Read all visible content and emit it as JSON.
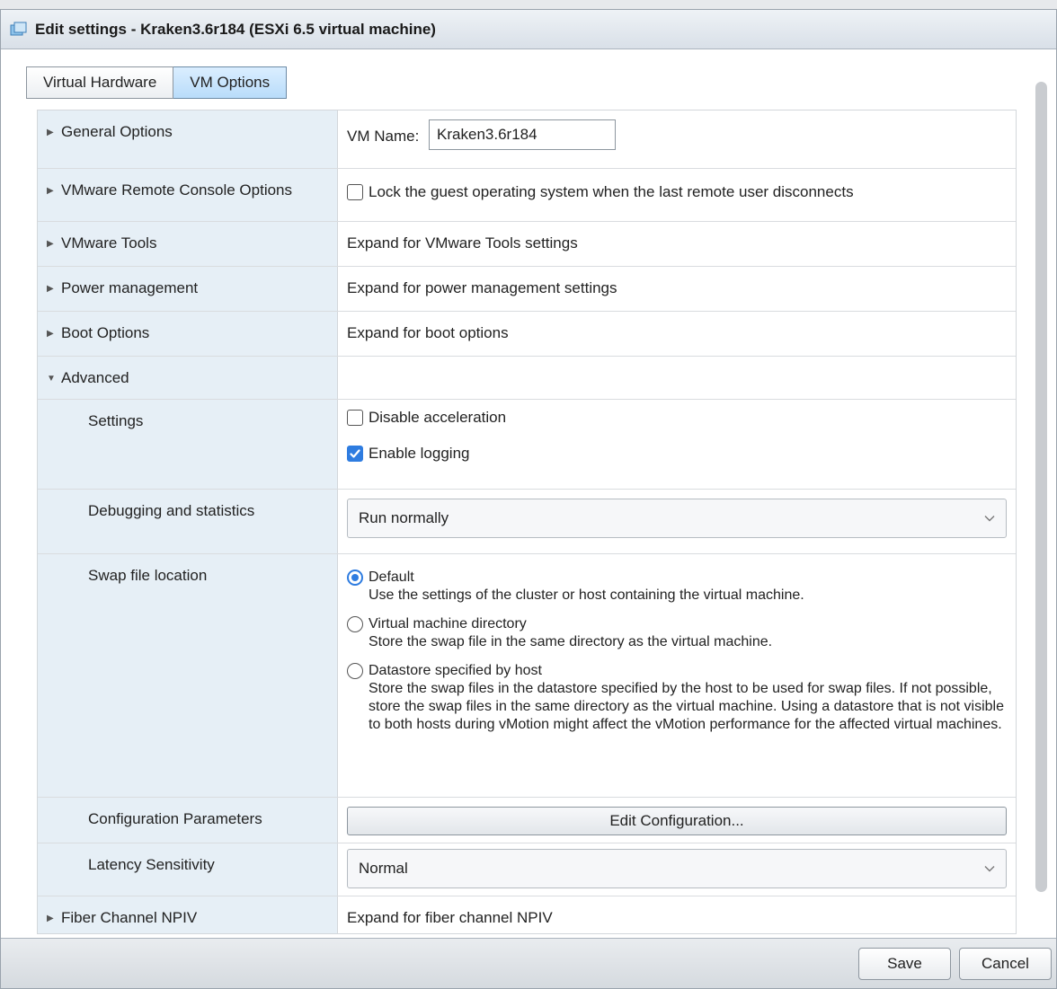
{
  "window": {
    "title": "Edit settings - Kraken3.6r184 (ESXi 6.5 virtual machine)"
  },
  "tabs": [
    {
      "label": "Virtual Hardware",
      "active": false
    },
    {
      "label": "VM Options",
      "active": true
    }
  ],
  "general_options": {
    "label": "General Options",
    "vm_name_label": "VM Name:",
    "vm_name_value": "Kraken3.6r184"
  },
  "remote_console": {
    "label": "VMware Remote Console Options",
    "lock_label": "Lock the guest operating system when the last remote user disconnects",
    "lock_checked": false
  },
  "vmware_tools": {
    "label": "VMware Tools",
    "value": "Expand for VMware Tools settings"
  },
  "power_management": {
    "label": "Power management",
    "value": "Expand for power management settings"
  },
  "boot_options": {
    "label": "Boot Options",
    "value": "Expand for boot options"
  },
  "advanced": {
    "label": "Advanced",
    "settings": {
      "label": "Settings",
      "disable_acceleration": {
        "label": "Disable acceleration",
        "checked": false
      },
      "enable_logging": {
        "label": "Enable logging",
        "checked": true
      }
    },
    "debugging": {
      "label": "Debugging and statistics",
      "selected": "Run normally"
    },
    "swap": {
      "label": "Swap file location",
      "options": [
        {
          "title": "Default",
          "desc": "Use the settings of the cluster or host containing the virtual machine.",
          "selected": true
        },
        {
          "title": "Virtual machine directory",
          "desc": "Store the swap file in the same directory as the virtual machine.",
          "selected": false
        },
        {
          "title": "Datastore specified by host",
          "desc": "Store the swap files in the datastore specified by the host to be used for swap files. If not possible, store the swap files in the same directory as the virtual machine. Using a datastore that is not visible to both hosts during vMotion might affect the vMotion performance for the affected virtual machines.",
          "selected": false
        }
      ]
    },
    "config_params": {
      "label": "Configuration Parameters",
      "button": "Edit Configuration..."
    },
    "latency": {
      "label": "Latency Sensitivity",
      "selected": "Normal"
    }
  },
  "fiber_channel": {
    "label": "Fiber Channel NPIV",
    "value": "Expand for fiber channel NPIV"
  },
  "footer": {
    "save": "Save",
    "cancel": "Cancel"
  },
  "icons": {
    "window_icon": "vm-icon",
    "collapsed": "caret-right-icon",
    "expanded": "caret-down-icon",
    "dropdown": "chevron-down-icon",
    "checked": "checkmark-icon"
  },
  "colors": {
    "accent": "#2e7ce0",
    "active_tab": "#b9dcfa",
    "label_column": "#e6eff6"
  }
}
